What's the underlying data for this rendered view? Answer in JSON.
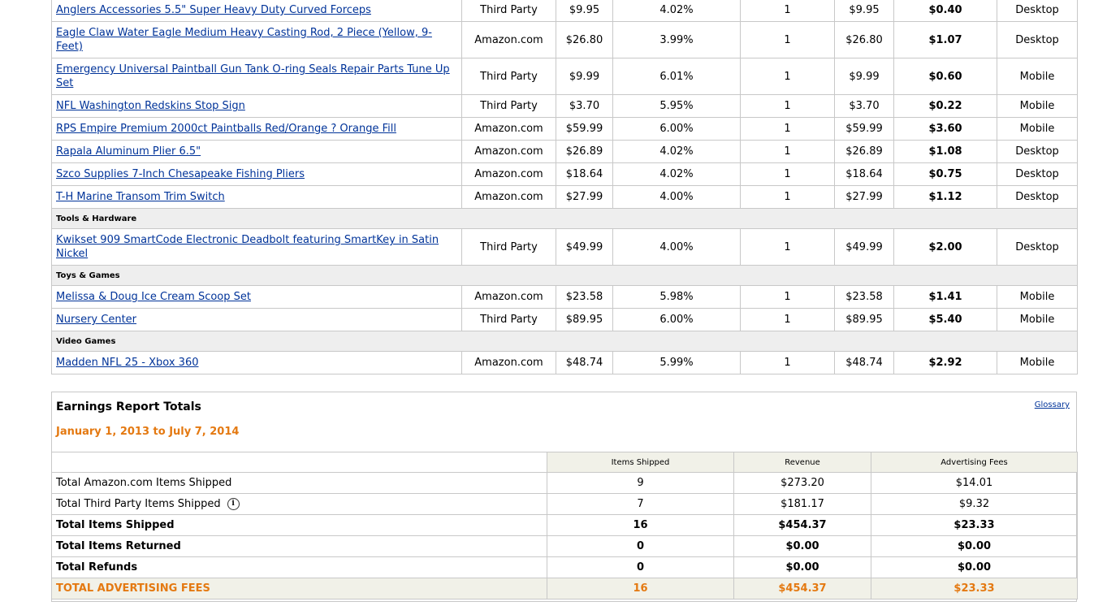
{
  "items": [
    {
      "type": "row",
      "name": "Anglers Accessories 5.5\" Super Heavy Duty Curved Forceps",
      "seller": "Third Party",
      "price": "$9.95",
      "rate": "4.02%",
      "qty": "1",
      "revenue": "$9.95",
      "fee": "$0.40",
      "device": "Desktop"
    },
    {
      "type": "row",
      "name": "Eagle Claw Water Eagle Medium Heavy Casting Rod, 2 Piece (Yellow, 9-Feet)",
      "seller": "Amazon.com",
      "price": "$26.80",
      "rate": "3.99%",
      "qty": "1",
      "revenue": "$26.80",
      "fee": "$1.07",
      "device": "Desktop"
    },
    {
      "type": "row",
      "name": "Emergency Universal Paintball Gun Tank O-ring Seals Repair Parts Tune Up Set",
      "seller": "Third Party",
      "price": "$9.99",
      "rate": "6.01%",
      "qty": "1",
      "revenue": "$9.99",
      "fee": "$0.60",
      "device": "Mobile"
    },
    {
      "type": "row",
      "name": "NFL Washington Redskins Stop Sign",
      "seller": "Third Party",
      "price": "$3.70",
      "rate": "5.95%",
      "qty": "1",
      "revenue": "$3.70",
      "fee": "$0.22",
      "device": "Mobile"
    },
    {
      "type": "row",
      "name": "RPS Empire Premium 2000ct Paintballs Red/Orange ? Orange Fill",
      "seller": "Amazon.com",
      "price": "$59.99",
      "rate": "6.00%",
      "qty": "1",
      "revenue": "$59.99",
      "fee": "$3.60",
      "device": "Mobile"
    },
    {
      "type": "row",
      "name": "Rapala Aluminum Plier 6.5\"",
      "seller": "Amazon.com",
      "price": "$26.89",
      "rate": "4.02%",
      "qty": "1",
      "revenue": "$26.89",
      "fee": "$1.08",
      "device": "Desktop"
    },
    {
      "type": "row",
      "name": "Szco Supplies 7-Inch Chesapeake Fishing Pliers",
      "seller": "Amazon.com",
      "price": "$18.64",
      "rate": "4.02%",
      "qty": "1",
      "revenue": "$18.64",
      "fee": "$0.75",
      "device": "Desktop"
    },
    {
      "type": "row",
      "name": "T-H Marine Transom Trim Switch",
      "seller": "Amazon.com",
      "price": "$27.99",
      "rate": "4.00%",
      "qty": "1",
      "revenue": "$27.99",
      "fee": "$1.12",
      "device": "Desktop"
    },
    {
      "type": "category",
      "label": "Tools & Hardware"
    },
    {
      "type": "row",
      "name": "Kwikset 909 SmartCode Electronic Deadbolt featuring SmartKey in Satin Nickel",
      "seller": "Third Party",
      "price": "$49.99",
      "rate": "4.00%",
      "qty": "1",
      "revenue": "$49.99",
      "fee": "$2.00",
      "device": "Desktop"
    },
    {
      "type": "category",
      "label": "Toys & Games"
    },
    {
      "type": "row",
      "name": "Melissa & Doug Ice Cream Scoop Set",
      "seller": "Amazon.com",
      "price": "$23.58",
      "rate": "5.98%",
      "qty": "1",
      "revenue": "$23.58",
      "fee": "$1.41",
      "device": "Mobile"
    },
    {
      "type": "row",
      "name": "Nursery Center",
      "seller": "Third Party",
      "price": "$89.95",
      "rate": "6.00%",
      "qty": "1",
      "revenue": "$89.95",
      "fee": "$5.40",
      "device": "Mobile"
    },
    {
      "type": "category",
      "label": "Video Games"
    },
    {
      "type": "row",
      "name": "Madden NFL 25 - Xbox 360",
      "seller": "Amazon.com",
      "price": "$48.74",
      "rate": "5.99%",
      "qty": "1",
      "revenue": "$48.74",
      "fee": "$2.92",
      "device": "Mobile"
    }
  ],
  "totals": {
    "title": "Earnings Report Totals",
    "glossary": "Glossary",
    "date_range": "January 1, 2013 to July 7, 2014",
    "headers": [
      "Items Shipped",
      "Revenue",
      "Advertising Fees"
    ],
    "rows": [
      {
        "label": "Total Amazon.com Items Shipped",
        "shipped": "9",
        "revenue": "$273.20",
        "fees": "$14.01"
      },
      {
        "label": "Total Third Party Items Shipped",
        "shipped": "7",
        "revenue": "$181.17",
        "fees": "$9.32",
        "info": "i"
      },
      {
        "label": "Total Items Shipped",
        "shipped": "16",
        "revenue": "$454.37",
        "fees": "$23.33",
        "bold": true
      },
      {
        "label": "Total Items Returned",
        "shipped": "0",
        "revenue": "$0.00",
        "fees": "$0.00",
        "bold": true
      },
      {
        "label": "Total Refunds",
        "shipped": "0",
        "revenue": "$0.00",
        "fees": "$0.00",
        "bold": true
      },
      {
        "label": "TOTAL ADVERTISING FEES",
        "shipped": "16",
        "revenue": "$454.37",
        "fees": "$23.33",
        "grand": true
      }
    ]
  }
}
